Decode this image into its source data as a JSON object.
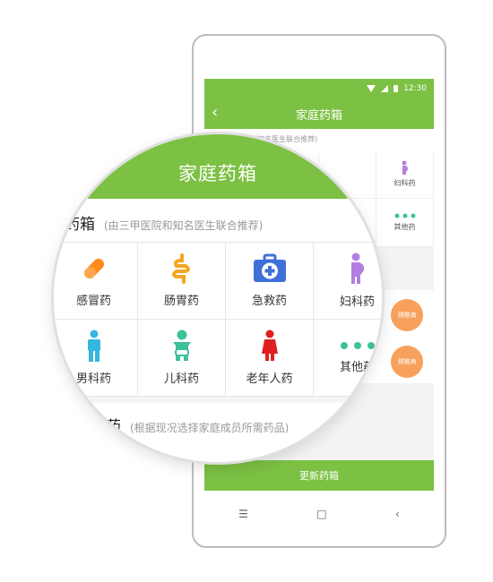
{
  "statusbar": {
    "time": "12:30"
  },
  "appbar": {
    "title": "家庭药箱",
    "back_icon": "back-arrow-icon"
  },
  "section1": {
    "title_prefix": "常用药箱",
    "subtitle": "(由三甲医院和知名医生联合推荐)",
    "items": [
      {
        "label": "感冒药",
        "icon": "capsule-icon"
      },
      {
        "label": "肠胃药",
        "icon": "intestine-icon"
      },
      {
        "label": "急救药",
        "icon": "first-aid-kit-icon"
      },
      {
        "label": "妇科药",
        "icon": "pregnant-woman-icon"
      },
      {
        "label": "男科药",
        "icon": "man-icon"
      },
      {
        "label": "儿科药",
        "icon": "baby-icon"
      },
      {
        "label": "老年人药",
        "icon": "elder-icon"
      },
      {
        "label": "其他药",
        "icon": "more-dots-icon"
      }
    ]
  },
  "section2": {
    "title_suffix": "药",
    "subtitle": "(根据现况选择家庭成员所需药品)"
  },
  "cards": [
    {
      "label": "颈椎病"
    },
    {
      "label": "颈椎病"
    }
  ],
  "update_button": {
    "label": "更新药箱"
  },
  "colors": {
    "brand_green": "#7cc144",
    "orange": "#f7a15c"
  }
}
